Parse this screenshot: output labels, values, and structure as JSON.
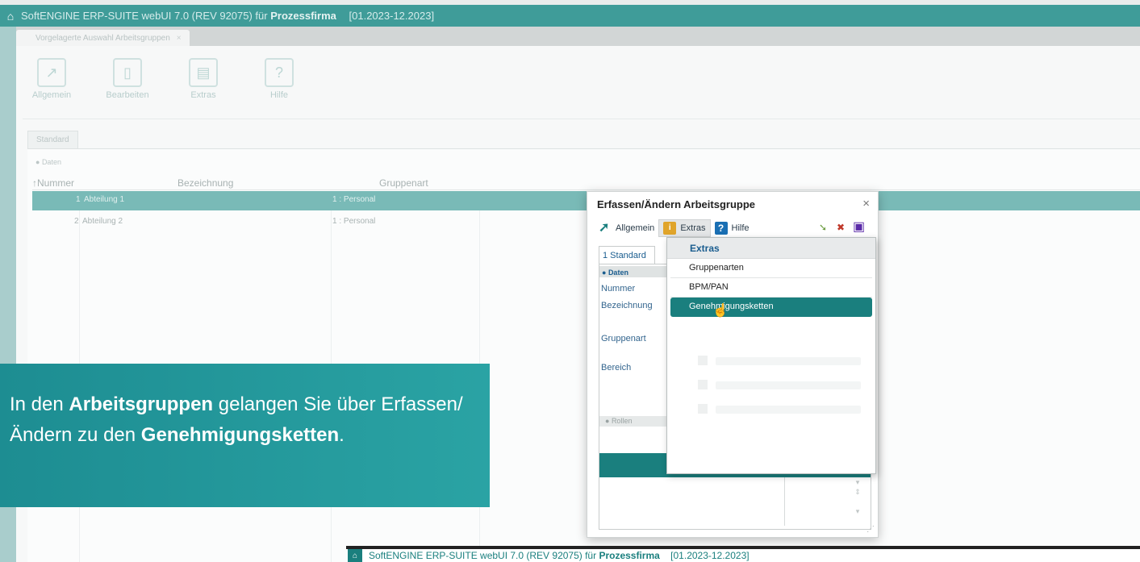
{
  "background": {
    "titlebar": {
      "app": "SoftENGINE ERP-SUITE webUI 7.0 (REV 92075) für",
      "company": "Prozessfirma",
      "period": "[01.2023-12.2023]"
    },
    "tab_label": "Vorgelagerte Auswahl Arbeitsgruppen",
    "toolbar": [
      {
        "label": "Allgemein",
        "icon": "arrow-icon"
      },
      {
        "label": "Bearbeiten",
        "icon": "edit-icon"
      },
      {
        "label": "Extras",
        "icon": "extras-icon"
      },
      {
        "label": "Hilfe",
        "icon": "help-icon"
      }
    ],
    "std_tab": "Standard",
    "daten_label": "Daten",
    "columns": [
      "Nummer",
      "Bezeichnung",
      "Gruppenart"
    ],
    "rows": [
      {
        "nummer": "1",
        "bezeichnung": "Abteilung 1",
        "gruppenart": "1 : Personal"
      },
      {
        "nummer": "2",
        "bezeichnung": "Abteilung 2",
        "gruppenart": "1 : Personal"
      }
    ]
  },
  "caption": {
    "p1": "In den ",
    "b1": "Arbeitsgruppen",
    "p2": " gelangen Sie über Erfassen/Ändern zu den ",
    "b2": "Genehmigungsketten",
    "p3": "."
  },
  "dialog": {
    "title": "Erfassen/Ändern Arbeitsgruppe",
    "close": "×",
    "toolbar": {
      "allgemein": "Allgemein",
      "extras": "Extras",
      "hilfe": "Hilfe"
    },
    "tab": "1 Standard",
    "daten": "Daten",
    "labels": {
      "nummer": "Nummer",
      "bezeichnung": "Bezeichnung",
      "gruppenart": "Gruppenart",
      "bereich": "Bereich"
    },
    "rollen": "Rollen"
  },
  "menu": {
    "header": "Extras",
    "items": [
      "Gruppenarten",
      "BPM/PAN",
      "Genehmigungsketten"
    ],
    "highlighted_index": 2
  },
  "bottombar": {
    "app": "SoftENGINE ERP-SUITE webUI 7.0 (REV 92075) für",
    "company": "Prozessfirma",
    "period": "[01.2023-12.2023]"
  },
  "colors": {
    "teal": "#1a7f7e",
    "caption_bg": "#2aa3a4",
    "link_blue": "#1a5d8f"
  }
}
